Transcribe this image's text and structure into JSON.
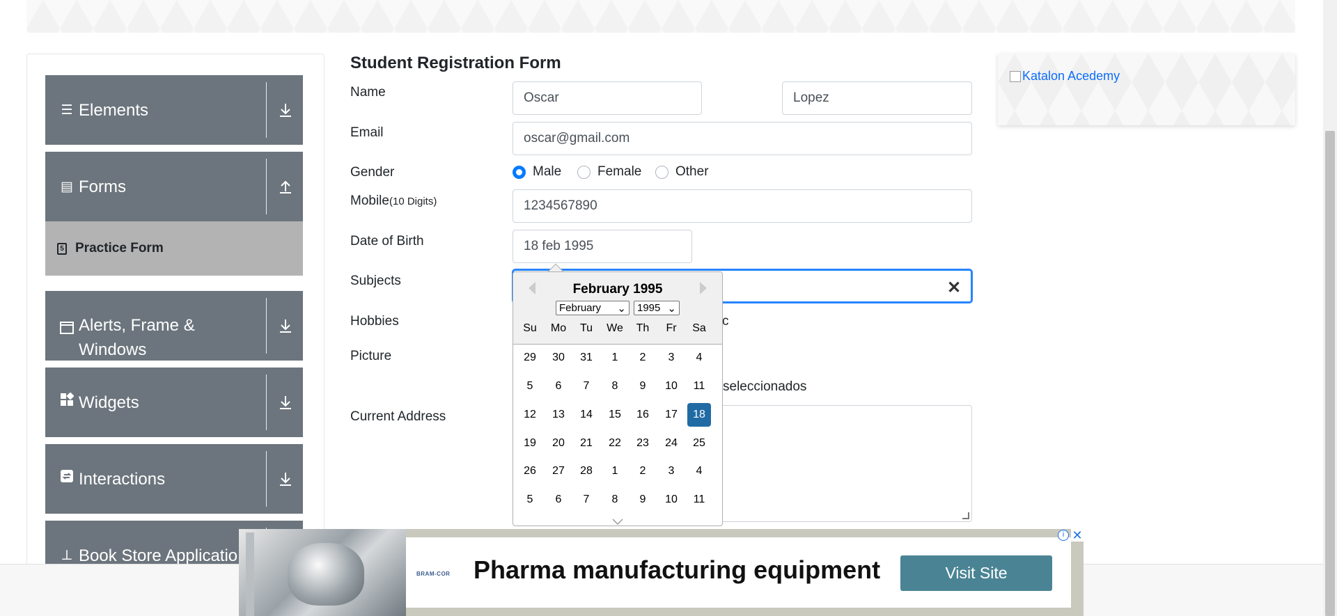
{
  "sidebar": {
    "groups": [
      {
        "label": "Elements",
        "icon": "hamburger-icon",
        "arrow": "download-arrow-icon"
      },
      {
        "label": "Forms",
        "icon": "document-icon",
        "arrow": "upload-arrow-icon"
      },
      {
        "label": "Alerts, Frame & Windows",
        "label_line1": "Alerts, Frame &",
        "label_line2": "Windows",
        "icon": "window-icon",
        "arrow": "download-arrow-icon"
      },
      {
        "label": "Widgets",
        "icon": "widgets-icon",
        "arrow": "download-arrow-icon"
      },
      {
        "label": "Interactions",
        "icon": "interactions-icon",
        "arrow": "download-arrow-icon"
      },
      {
        "label": "Book Store Applicatio",
        "icon": "books-icon"
      }
    ],
    "active_item": "Practice Form"
  },
  "form": {
    "title": "Student Registration Form",
    "name_label": "Name",
    "first_name": "Oscar",
    "last_name": "Lopez",
    "email_label": "Email",
    "email": "oscar@gmail.com",
    "gender_label": "Gender",
    "gender_options": [
      "Male",
      "Female",
      "Other"
    ],
    "gender_selected": "Male",
    "mobile_label": "Mobile",
    "mobile_hint": "(10 Digits)",
    "mobile": "1234567890",
    "dob_label": "Date of Birth",
    "dob": "18 feb 1995",
    "subjects_label": "Subjects",
    "hobbies_label": "Hobbies",
    "hobbies_visible_fragment": "c",
    "picture_label": "Picture",
    "picture_visible_fragment": "seleccionados",
    "address_label": "Current Address"
  },
  "datepicker": {
    "header": "February 1995",
    "month_select": "February",
    "year_select": "1995",
    "weekdays": [
      "Su",
      "Mo",
      "Tu",
      "We",
      "Th",
      "Fr",
      "Sa"
    ],
    "weeks": [
      [
        "29",
        "30",
        "31",
        "1",
        "2",
        "3",
        "4"
      ],
      [
        "5",
        "6",
        "7",
        "8",
        "9",
        "10",
        "11"
      ],
      [
        "12",
        "13",
        "14",
        "15",
        "16",
        "17",
        "18"
      ],
      [
        "19",
        "20",
        "21",
        "22",
        "23",
        "24",
        "25"
      ],
      [
        "26",
        "27",
        "28",
        "1",
        "2",
        "3",
        "4"
      ],
      [
        "5",
        "6",
        "7",
        "8",
        "9",
        "10",
        "11"
      ]
    ],
    "selected_day": "18"
  },
  "side_ad": {
    "alt_text": "Katalon Acedemy"
  },
  "bottom_ad": {
    "logo_text": "BRAM-COR",
    "headline": "Pharma manufacturing equipment",
    "cta": "Visit Site",
    "info_glyph": "i",
    "close_glyph": "✕"
  },
  "colors": {
    "sidebar_group": "#6c757d",
    "active_item": "#b3b3b3",
    "selected_day": "#216ba5",
    "radio_on": "#007bff",
    "focus_border": "#2684ff",
    "ad_button": "#4a8494"
  }
}
